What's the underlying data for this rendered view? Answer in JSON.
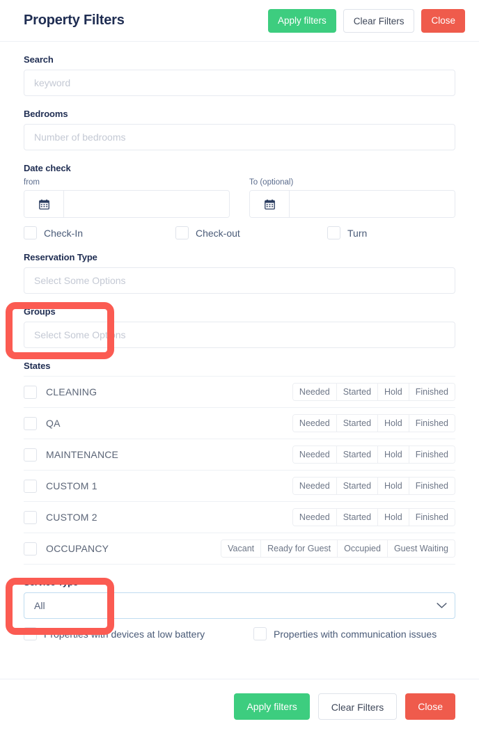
{
  "header": {
    "title": "Property Filters",
    "apply_label": "Apply filters",
    "clear_label": "Clear Filters",
    "close_label": "Close"
  },
  "search": {
    "label": "Search",
    "placeholder": "keyword",
    "value": ""
  },
  "bedrooms": {
    "label": "Bedrooms",
    "placeholder": "Number of bedrooms",
    "value": ""
  },
  "date_check": {
    "label": "Date check",
    "from": {
      "label": "from",
      "placeholder": "",
      "value": "",
      "icon": "calendar-icon",
      "glyph": "📅"
    },
    "to": {
      "label": "To (optional)",
      "placeholder": "",
      "value": "",
      "icon": "calendar-icon",
      "glyph": "📅"
    },
    "checkboxes": [
      {
        "label": "Check-In",
        "checked": false
      },
      {
        "label": "Check-out",
        "checked": false
      },
      {
        "label": "Turn",
        "checked": false
      }
    ]
  },
  "reservation_type": {
    "label": "Reservation Type",
    "placeholder": "Select Some Options",
    "value": ""
  },
  "groups": {
    "label": "Groups",
    "placeholder": "Select Some Options",
    "value": ""
  },
  "states": {
    "label": "States",
    "rows": [
      {
        "name": "CLEANING",
        "checked": false,
        "pills": [
          "Needed",
          "Started",
          "Hold",
          "Finished"
        ]
      },
      {
        "name": "QA",
        "checked": false,
        "pills": [
          "Needed",
          "Started",
          "Hold",
          "Finished"
        ]
      },
      {
        "name": "MAINTENANCE",
        "checked": false,
        "pills": [
          "Needed",
          "Started",
          "Hold",
          "Finished"
        ]
      },
      {
        "name": "CUSTOM 1",
        "checked": false,
        "pills": [
          "Needed",
          "Started",
          "Hold",
          "Finished"
        ]
      },
      {
        "name": "CUSTOM 2",
        "checked": false,
        "pills": [
          "Needed",
          "Started",
          "Hold",
          "Finished"
        ]
      },
      {
        "name": "OCCUPANCY",
        "checked": false,
        "pills": [
          "Vacant",
          "Ready for Guest",
          "Occupied",
          "Guest Waiting"
        ]
      }
    ]
  },
  "service_type": {
    "label": "Service Type",
    "selected": "All",
    "chevron": "chevron-down-icon"
  },
  "bottom_checkboxes": [
    {
      "label": "Properties with devices at low battery",
      "checked": false
    },
    {
      "label": "Properties with communication issues",
      "checked": false
    }
  ],
  "footer": {
    "apply_label": "Apply filters",
    "clear_label": "Clear Filters",
    "close_label": "Close"
  },
  "colors": {
    "accent_green": "#3dcd7f",
    "accent_red": "#ef5b4c",
    "title_navy": "#1f2d52",
    "annotation_red": "#fb5b52",
    "select_border_blue": "#bfdcf0"
  }
}
